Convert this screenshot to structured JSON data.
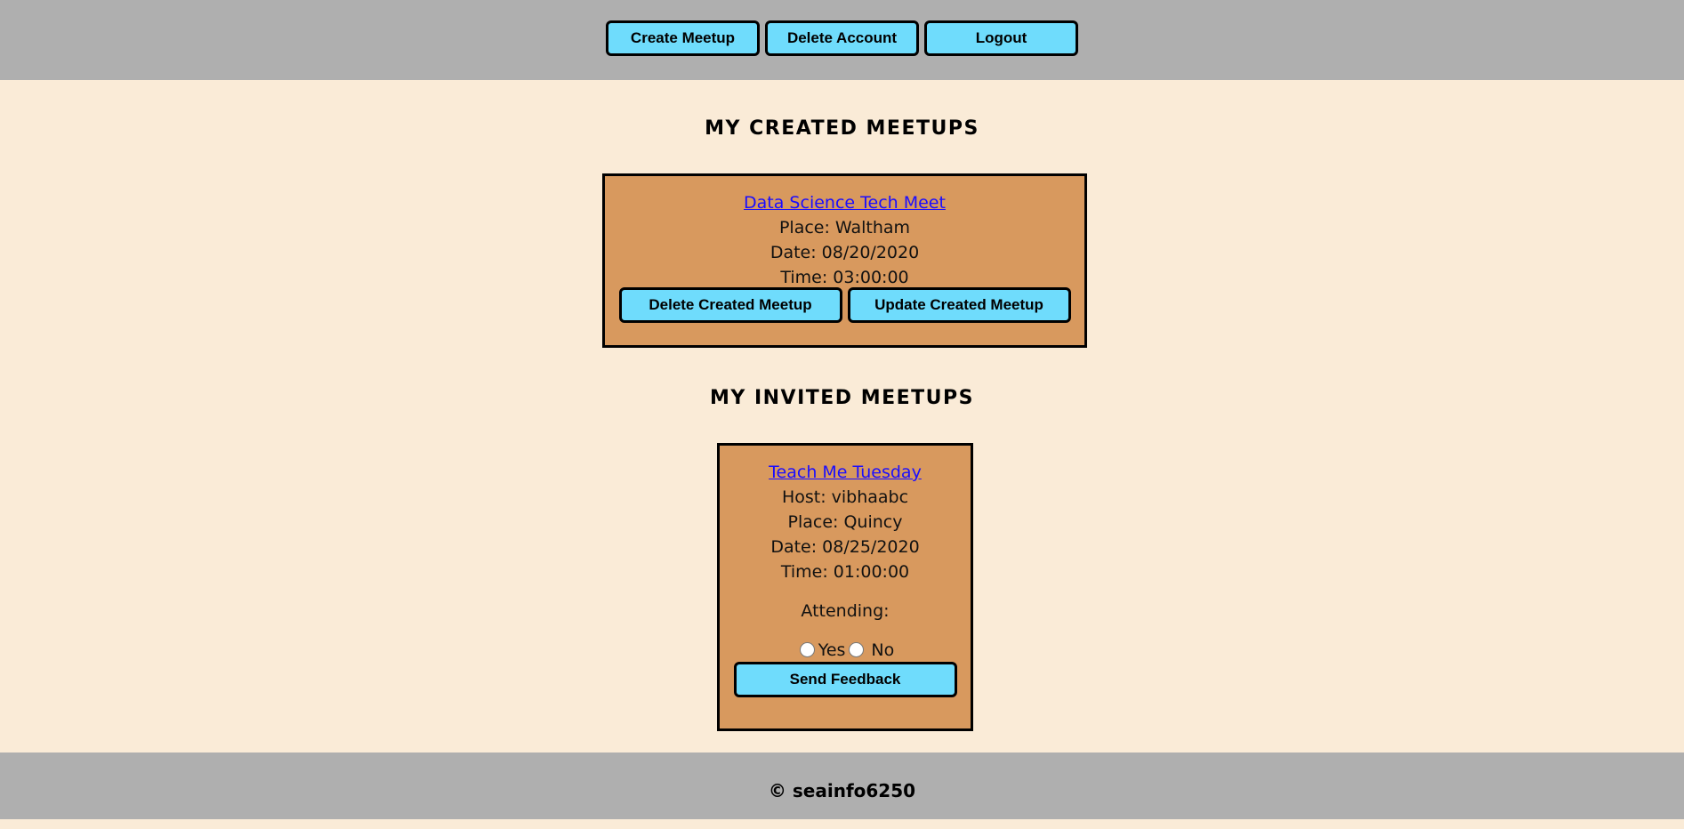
{
  "header": {
    "buttons": [
      "Create Meetup",
      "Delete Account",
      "Logout"
    ]
  },
  "created": {
    "title": "MY CREATED MEETUPS",
    "meetups": [
      {
        "name": "Data Science Tech Meet",
        "place": "Place: Waltham",
        "date": "Date: 08/20/2020",
        "time": "Time: 03:00:00",
        "delete_label": "Delete Created Meetup",
        "update_label": "Update Created Meetup"
      }
    ]
  },
  "invited": {
    "title": "MY INVITED MEETUPS",
    "meetups": [
      {
        "name": "Teach Me Tuesday",
        "host": "Host: vibhaabc",
        "place": "Place: Quincy",
        "date": "Date: 08/25/2020",
        "time": "Time: 01:00:00",
        "attending_label": "Attending:",
        "yes_label": "Yes",
        "no_label": "No",
        "feedback_label": "Send Feedback"
      }
    ]
  },
  "footer": {
    "text": "© seainfo6250"
  }
}
